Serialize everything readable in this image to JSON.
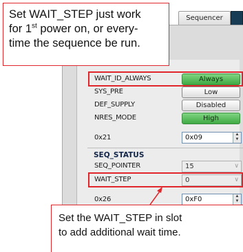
{
  "tabs": {
    "sequencer": "Sequencer"
  },
  "settings": {
    "wait_id_always": {
      "label": "WAIT_ID_ALWAYS",
      "value": "Always"
    },
    "sys_pre": {
      "label": "SYS_PRE",
      "value": "Low"
    },
    "def_supply": {
      "label": "DEF_SUPPLY",
      "value": "Disabled"
    },
    "nres_mode": {
      "label": "NRES_MODE",
      "value": "High"
    },
    "reg_0x21": {
      "label": "0x21",
      "value": "0x09"
    }
  },
  "seq_status": {
    "title": "SEQ_STATUS",
    "seq_pointer": {
      "label": "SEQ_POINTER",
      "value": "15"
    },
    "wait_step": {
      "label": "WAIT_STEP",
      "value": "0"
    },
    "reg_0x26": {
      "label": "0x26",
      "value": "0xF0"
    }
  },
  "callouts": {
    "top_line1": "Set WAIT_STEP just work",
    "top_line2_pre": "for 1",
    "top_line2_sup": "st",
    "top_line2_post": " power on, or every-",
    "top_line3": "time the sequence be run.",
    "bottom_line1": "Set the WAIT_STEP in slot",
    "bottom_line2": "to add additional wait time."
  },
  "colors": {
    "highlight": "#e0262b",
    "toggle_green": "#3faa44",
    "section_title": "#13264a"
  }
}
